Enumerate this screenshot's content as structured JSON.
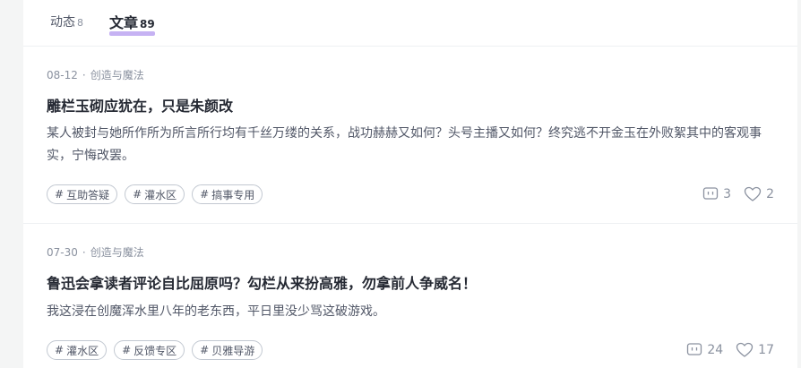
{
  "tabs": [
    {
      "label": "动态",
      "count": "8"
    },
    {
      "label": "文章",
      "count": "89"
    }
  ],
  "articles": [
    {
      "date": "08-12",
      "separator": "·",
      "category": "创造与魔法",
      "title": "雕栏玉砌应犹在，只是朱颜改",
      "excerpt": "某人被封与她所作所为所言所行均有千丝万缕的关系，战功赫赫又如何？头号主播又如何？终究逃不开金玉在外败絮其中的客观事实，宁悔改罢。",
      "tags": [
        "互助答疑",
        "灌水区",
        "搞事专用"
      ],
      "comments": "3",
      "likes": "2"
    },
    {
      "date": "07-30",
      "separator": "·",
      "category": "创造与魔法",
      "title": "鲁迅会拿读者评论自比屈原吗？勾栏从来扮高雅，勿拿前人争威名！",
      "excerpt": "我这浸在创魔浑水里八年的老东西，平日里没少骂这破游戏。",
      "tags": [
        "灌水区",
        "反馈专区",
        "贝雅导游"
      ],
      "comments": "24",
      "likes": "17"
    }
  ],
  "icons": {
    "comment": "comment-icon",
    "like": "heart-icon",
    "tag_prefix": "#"
  },
  "colors": {
    "accent_underline": "#8d66e8",
    "text_primary": "#252933",
    "text_secondary": "#8a919f",
    "page_bg": "#f4f5f5"
  }
}
